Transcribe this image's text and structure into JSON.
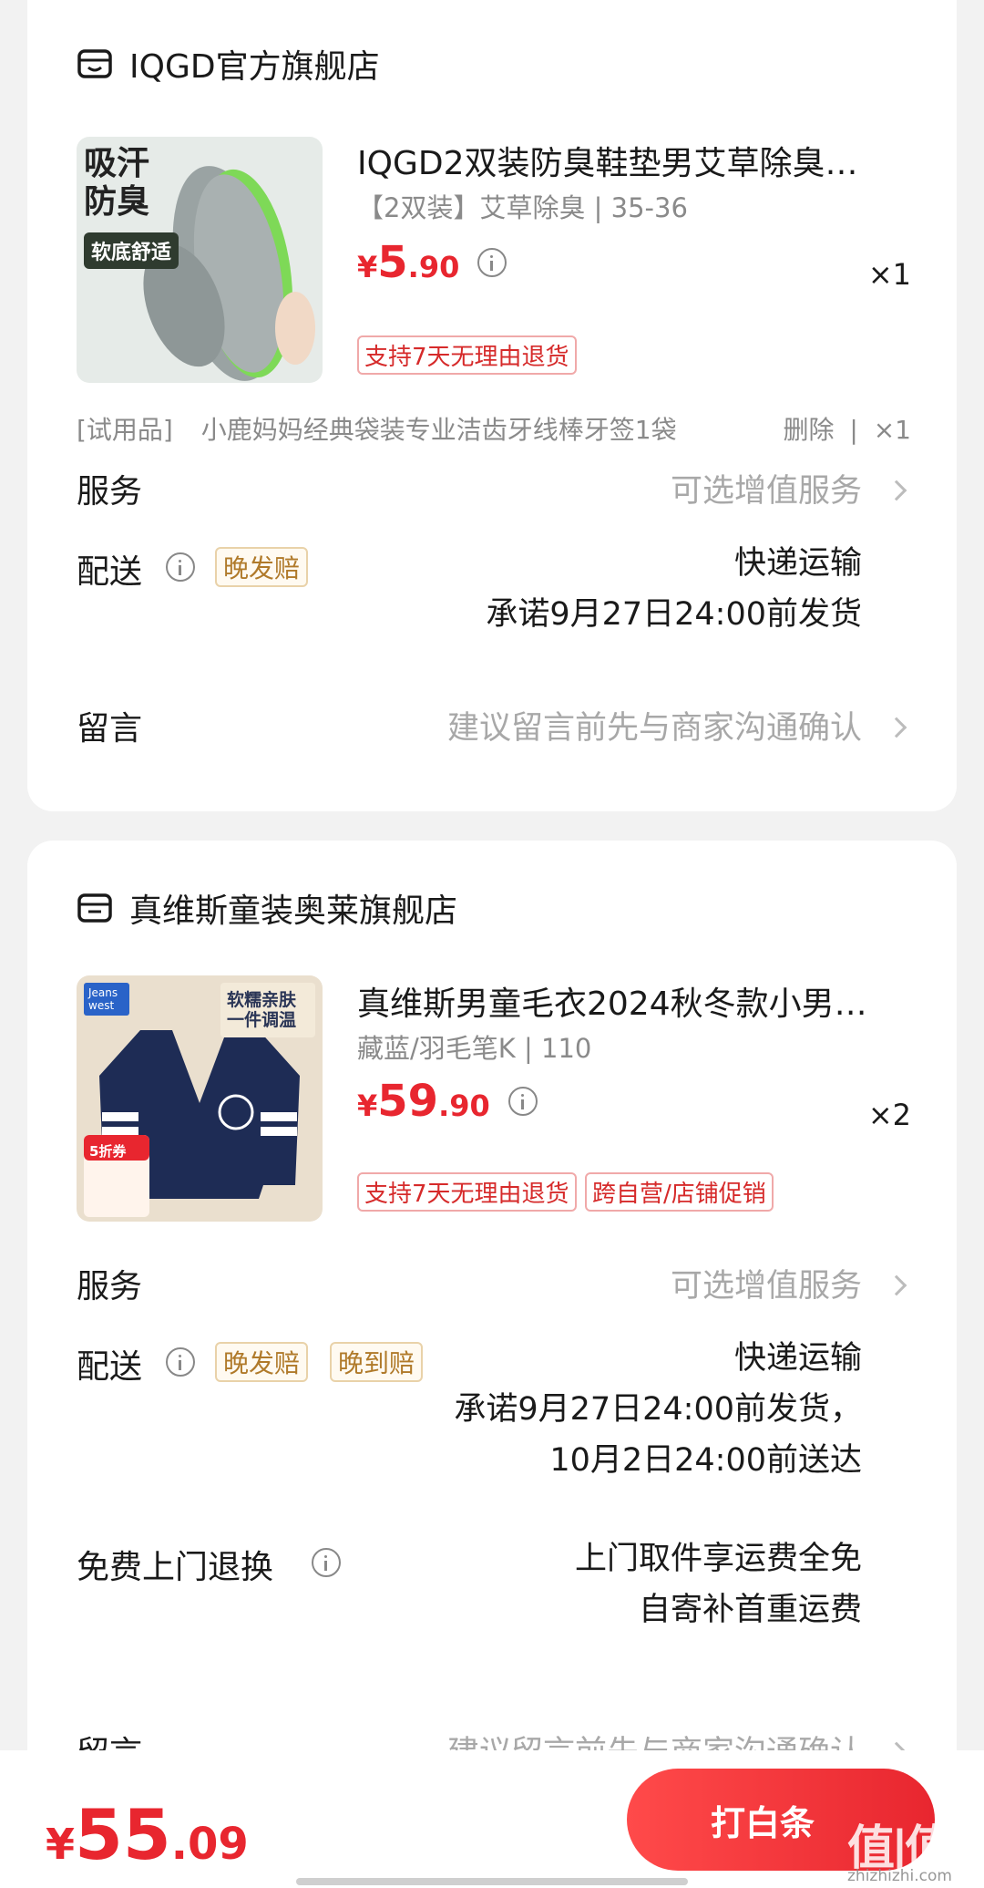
{
  "stores": [
    {
      "name": "IQGD官方旗舰店",
      "product": {
        "title": "IQGD2双装防臭鞋垫男艾草除臭…",
        "spec": "【2双装】艾草除臭 | 35-36",
        "price_yen": "¥",
        "price_int": "5",
        "price_dec": ".90",
        "qty": "×1",
        "tags": [
          "支持7天无理由退货"
        ],
        "image_text": [
          "吸汗",
          "防臭",
          "软底舒适"
        ]
      },
      "trial": {
        "label": "[试用品]",
        "name": "小鹿妈妈经典袋装专业洁齿牙线棒牙签1袋",
        "delete": "删除",
        "sep": "|",
        "qty": "×1"
      },
      "service": {
        "label": "服务",
        "hint": "可选增值服务"
      },
      "delivery": {
        "label": "配送",
        "badges": [
          "晚发赔"
        ],
        "lines": [
          "快递运输",
          "承诺9月27日24:00前发货"
        ]
      },
      "message": {
        "label": "留言",
        "hint": "建议留言前先与商家沟通确认"
      }
    },
    {
      "name": "真维斯童装奥莱旗舰店",
      "product": {
        "title": "真维斯男童毛衣2024秋冬款小男…",
        "spec": "藏蓝/羽毛笔K | 110",
        "price_yen": "¥",
        "price_int": "59",
        "price_dec": ".90",
        "qty": "×2",
        "tags": [
          "支持7天无理由退货",
          "跨自营/店铺促销"
        ],
        "image_text": [
          "Jeans west",
          "软糯亲肤",
          "一件调温",
          "5折券"
        ]
      },
      "service": {
        "label": "服务",
        "hint": "可选增值服务"
      },
      "delivery": {
        "label": "配送",
        "badges": [
          "晚发赔",
          "晚到赔"
        ],
        "lines": [
          "快递运输",
          "承诺9月27日24:00前发货，",
          "10月2日24:00前送达"
        ]
      },
      "return": {
        "label": "免费上门退换",
        "lines": [
          "上门取件享运费全免",
          "自寄补首重运费"
        ]
      },
      "message": {
        "label": "留言",
        "hint": "建议留言前先与商家沟通确认"
      }
    }
  ],
  "bottom": {
    "total_yen": "¥",
    "total_int": "55",
    "total_dec": ".09",
    "pay_label": "打白条"
  },
  "watermark": {
    "main": "值|值|值",
    "sub": "zhizhizhi.com"
  },
  "colors": {
    "accent": "#e8262f",
    "gold": "#b07a2a",
    "hint": "#a8a8a8"
  }
}
